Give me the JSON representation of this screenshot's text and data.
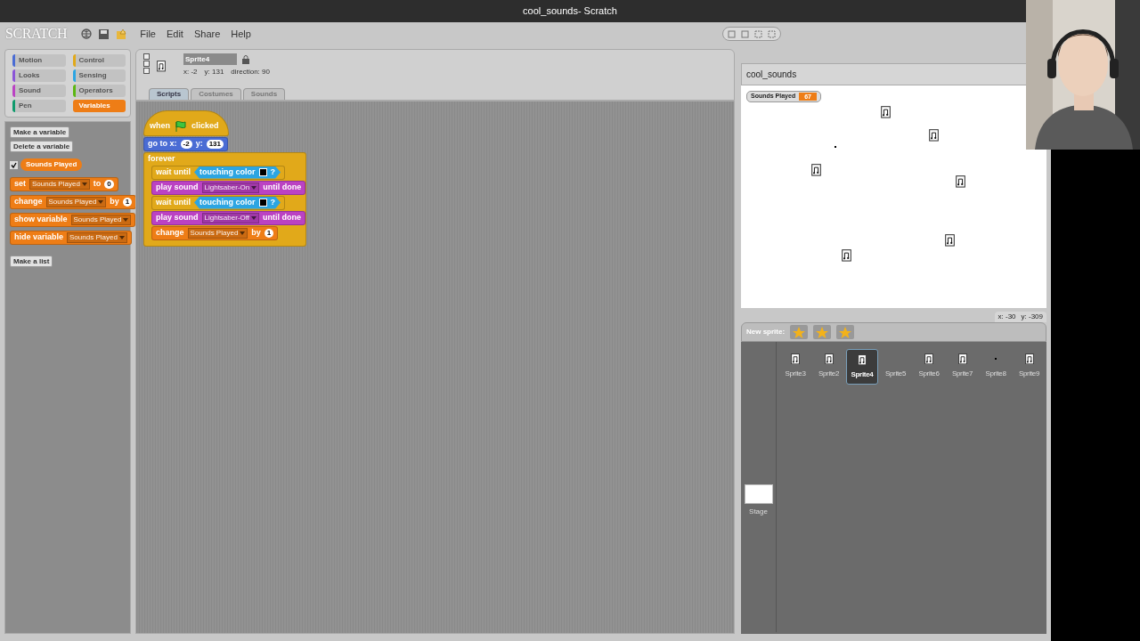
{
  "window": {
    "title": "cool_sounds- Scratch"
  },
  "logo": "SCRATCH",
  "menu": [
    "File",
    "Edit",
    "Share",
    "Help"
  ],
  "categories": [
    {
      "label": "Motion",
      "color": "#4a6cd4",
      "selected": false
    },
    {
      "label": "Control",
      "color": "#e1a91a",
      "selected": false
    },
    {
      "label": "Looks",
      "color": "#8a55d7",
      "selected": false
    },
    {
      "label": "Sensing",
      "color": "#2ca5e2",
      "selected": false
    },
    {
      "label": "Sound",
      "color": "#bb42c3",
      "selected": false
    },
    {
      "label": "Operators",
      "color": "#5cb712",
      "selected": false
    },
    {
      "label": "Pen",
      "color": "#0e9a6c",
      "selected": false
    },
    {
      "label": "Variables",
      "color": "#ee7d16",
      "selected": true
    }
  ],
  "palette": {
    "buttons": [
      "Make a variable",
      "Delete a variable"
    ],
    "variables": [
      {
        "name": "Sounds Played",
        "checked": true
      }
    ],
    "blocks": [
      {
        "kind": "command",
        "color": "#ee7d16",
        "parts": [
          {
            "kind": "text",
            "text": "set"
          },
          {
            "kind": "dropdown",
            "text": "Sounds Played"
          },
          {
            "kind": "text",
            "text": "to"
          },
          {
            "kind": "number",
            "text": "0"
          }
        ]
      },
      {
        "kind": "command",
        "color": "#ee7d16",
        "parts": [
          {
            "kind": "text",
            "text": "change"
          },
          {
            "kind": "dropdown",
            "text": "Sounds Played"
          },
          {
            "kind": "text",
            "text": "by"
          },
          {
            "kind": "number",
            "text": "1"
          }
        ]
      },
      {
        "kind": "command",
        "color": "#ee7d16",
        "parts": [
          {
            "kind": "text",
            "text": "show variable"
          },
          {
            "kind": "dropdown",
            "text": "Sounds Played"
          }
        ]
      },
      {
        "kind": "command",
        "color": "#ee7d16",
        "parts": [
          {
            "kind": "text",
            "text": "hide variable"
          },
          {
            "kind": "dropdown",
            "text": "Sounds Played"
          }
        ]
      }
    ],
    "list_button": "Make a list"
  },
  "sprite": {
    "name": "Sprite4",
    "x": "x: -2",
    "y": "y: 131",
    "direction": "direction: 90"
  },
  "tabs": [
    {
      "label": "Scripts",
      "selected": true
    },
    {
      "label": "Costumes",
      "selected": false
    },
    {
      "label": "Sounds",
      "selected": false
    }
  ],
  "script": [
    {
      "kind": "hat",
      "color": "#e1a91a",
      "parts": [
        {
          "kind": "text",
          "text": "when"
        },
        {
          "kind": "flag"
        },
        {
          "kind": "text",
          "text": "clicked"
        }
      ]
    },
    {
      "kind": "command",
      "color": "#4a6cd4",
      "parts": [
        {
          "kind": "text",
          "text": "go to x:"
        },
        {
          "kind": "number",
          "text": "-2"
        },
        {
          "kind": "text",
          "text": "y:"
        },
        {
          "kind": "number",
          "text": "131"
        }
      ]
    },
    {
      "kind": "forever",
      "color": "#e1a91a",
      "parts": [
        {
          "kind": "text",
          "text": "forever"
        }
      ],
      "children": [
        {
          "kind": "command",
          "color": "#e1a91a",
          "parts": [
            {
              "kind": "text",
              "text": "wait until"
            },
            {
              "kind": "predicate",
              "color": "#2ca5e2",
              "parts": [
                {
                  "kind": "text",
                  "text": "touching color"
                },
                {
                  "kind": "swatch",
                  "color": "#000000"
                },
                {
                  "kind": "text",
                  "text": "?"
                }
              ]
            }
          ]
        },
        {
          "kind": "command",
          "color": "#bb42c3",
          "parts": [
            {
              "kind": "text",
              "text": "play sound"
            },
            {
              "kind": "dropdown",
              "text": "Lightsaber-On"
            },
            {
              "kind": "text",
              "text": "until done"
            }
          ]
        },
        {
          "kind": "command",
          "color": "#e1a91a",
          "parts": [
            {
              "kind": "text",
              "text": "wait until"
            },
            {
              "kind": "predicate",
              "color": "#2ca5e2",
              "parts": [
                {
                  "kind": "text",
                  "text": "touching color"
                },
                {
                  "kind": "swatch",
                  "color": "#000000"
                },
                {
                  "kind": "text",
                  "text": "?"
                }
              ]
            }
          ]
        },
        {
          "kind": "command",
          "color": "#bb42c3",
          "parts": [
            {
              "kind": "text",
              "text": "play sound"
            },
            {
              "kind": "dropdown",
              "text": "Lightsaber-Off"
            },
            {
              "kind": "text",
              "text": "until done"
            }
          ]
        },
        {
          "kind": "command",
          "color": "#ee7d16",
          "parts": [
            {
              "kind": "text",
              "text": "change"
            },
            {
              "kind": "dropdown",
              "text": "Sounds Played"
            },
            {
              "kind": "text",
              "text": "by"
            },
            {
              "kind": "number",
              "text": "1"
            }
          ]
        }
      ]
    }
  ],
  "stage": {
    "title": "cool_sounds",
    "monitor": {
      "label": "Sounds Played",
      "value": "67"
    },
    "mouse_x": "x: -30",
    "mouse_y": "y: -309"
  },
  "new_sprite": "New sprite:",
  "sprites": [
    {
      "name": "Sprite3",
      "kind": "note",
      "selected": false
    },
    {
      "name": "Sprite2",
      "kind": "note",
      "selected": false
    },
    {
      "name": "Sprite4",
      "kind": "note",
      "selected": true
    },
    {
      "name": "Sprite5",
      "kind": "blank",
      "selected": false
    },
    {
      "name": "Sprite6",
      "kind": "note",
      "selected": false
    },
    {
      "name": "Sprite7",
      "kind": "note",
      "selected": false
    },
    {
      "name": "Sprite8",
      "kind": "dot",
      "selected": false
    },
    {
      "name": "Sprite9",
      "kind": "note",
      "selected": false
    }
  ],
  "stage_thumb": "Stage"
}
